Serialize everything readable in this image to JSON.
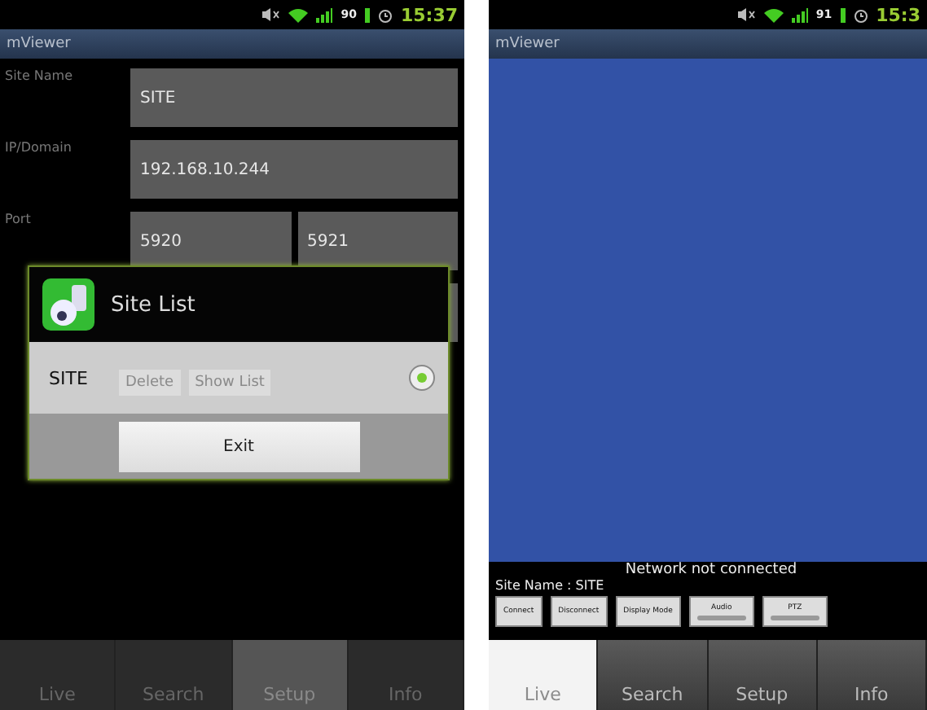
{
  "screens": [
    {
      "kind": "setup",
      "status_bar": {
        "battery": "90",
        "time": "15:37"
      },
      "app_title": "mViewer",
      "form": [
        {
          "label": "Site Name",
          "values": [
            "SITE"
          ]
        },
        {
          "label": "IP/Domain",
          "values": [
            "192.168.10.244"
          ]
        },
        {
          "label": "Port",
          "values": [
            "5920",
            "5921"
          ]
        }
      ],
      "buttons": [
        "Delete",
        "Show List"
      ],
      "dialog": {
        "title": "Site List",
        "items": [
          {
            "name": "SITE",
            "selected": true
          }
        ],
        "button": "Exit"
      },
      "tabs": [
        {
          "label": "Live",
          "selected": false
        },
        {
          "label": "Search",
          "selected": false
        },
        {
          "label": "Setup",
          "selected": true
        },
        {
          "label": "Info",
          "selected": false
        }
      ]
    },
    {
      "kind": "live",
      "status_bar": {
        "battery": "91",
        "time": "15:3"
      },
      "app_title": "mViewer",
      "status_message": "Network not connected",
      "site_name": "Site Name : SITE",
      "controls": [
        {
          "label": "Connect",
          "kind": "plain"
        },
        {
          "label": "Disconnect",
          "kind": "plain"
        },
        {
          "label": "Display Mode",
          "kind": "plain"
        },
        {
          "label": "Audio",
          "kind": "bar"
        },
        {
          "label": "PTZ",
          "kind": "bar"
        }
      ],
      "tabs": [
        {
          "label": "Live",
          "selected": true
        },
        {
          "label": "Search",
          "selected": false
        },
        {
          "label": "Setup",
          "selected": false
        },
        {
          "label": "Info",
          "selected": false
        }
      ]
    }
  ]
}
